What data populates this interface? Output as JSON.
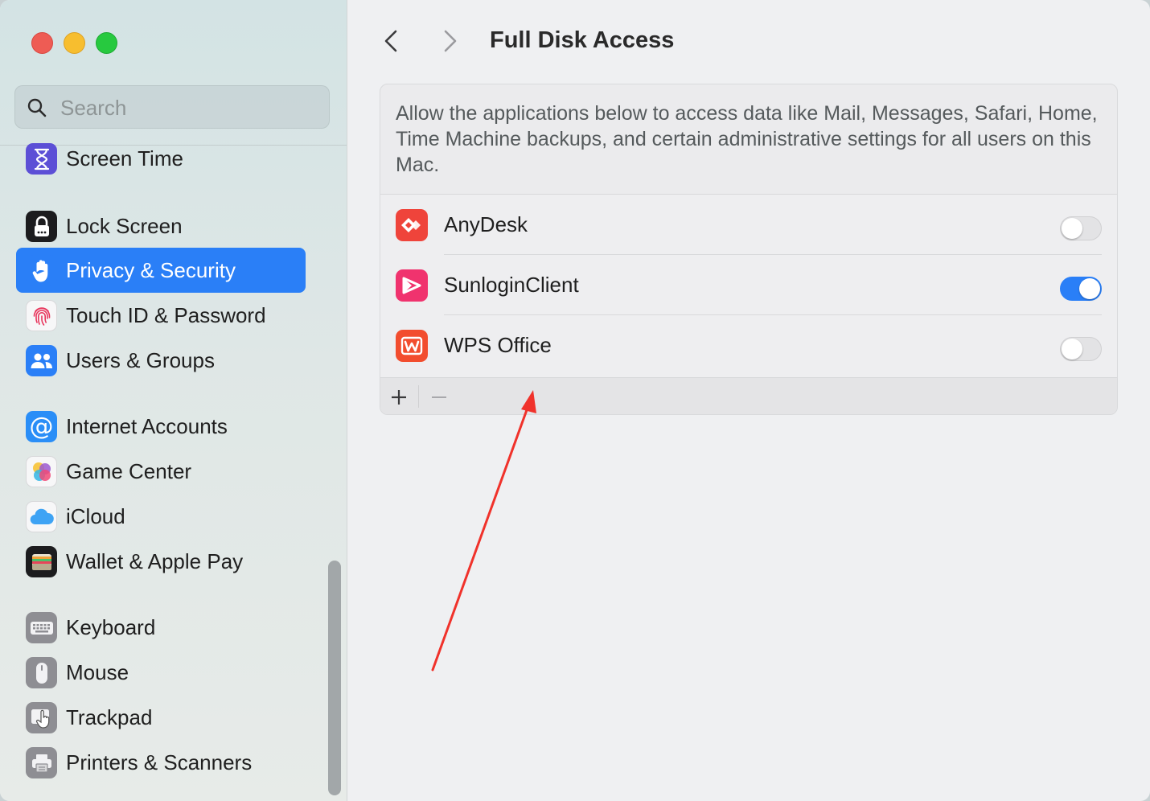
{
  "sidebar": {
    "search_placeholder": "Search",
    "items": [
      {
        "label": "Screen Time",
        "icon": "hourglass-icon",
        "color": "#5c4fd6",
        "selected": false
      },
      {
        "label": "Lock Screen",
        "icon": "lock-icon",
        "color": "#1c1c1e",
        "selected": false
      },
      {
        "label": "Privacy & Security",
        "icon": "hand-icon",
        "color": "#2a7ff7",
        "selected": true
      },
      {
        "label": "Touch ID & Password",
        "icon": "fingerprint-icon",
        "color": "#f2f2f4",
        "selected": false
      },
      {
        "label": "Users & Groups",
        "icon": "users-icon",
        "color": "#2a7ff7",
        "selected": false
      },
      {
        "label": "Internet Accounts",
        "icon": "at-icon",
        "color": "#2a8ef7",
        "selected": false
      },
      {
        "label": "Game Center",
        "icon": "game-center-icon",
        "color": "#f2f2f4",
        "selected": false
      },
      {
        "label": "iCloud",
        "icon": "cloud-icon",
        "color": "#f2f2f4",
        "selected": false
      },
      {
        "label": "Wallet & Apple Pay",
        "icon": "wallet-icon",
        "color": "#1c1c1e",
        "selected": false
      },
      {
        "label": "Keyboard",
        "icon": "keyboard-icon",
        "color": "#8e8e93",
        "selected": false
      },
      {
        "label": "Mouse",
        "icon": "mouse-icon",
        "color": "#8e8e93",
        "selected": false
      },
      {
        "label": "Trackpad",
        "icon": "trackpad-icon",
        "color": "#8e8e93",
        "selected": false
      },
      {
        "label": "Printers & Scanners",
        "icon": "printer-icon",
        "color": "#8e8e93",
        "selected": false
      }
    ]
  },
  "main": {
    "title": "Full Disk Access",
    "description": "Allow the applications below to access data like Mail, Messages, Safari, Home, Time Machine backups, and certain administrative settings for all users on this Mac.",
    "apps": [
      {
        "name": "AnyDesk",
        "icon": "anydesk-icon",
        "color": "#ef443b",
        "enabled": false
      },
      {
        "name": "SunloginClient",
        "icon": "sunlogin-icon",
        "color": "#f0336e",
        "enabled": true
      },
      {
        "name": "WPS Office",
        "icon": "wps-office-icon",
        "color": "#f24d2e",
        "enabled": false
      }
    ],
    "footer": {
      "add_symbol": "+",
      "remove_symbol": "−"
    }
  },
  "colors": {
    "accent": "#2a7ff7",
    "annotation": "#f0322b"
  }
}
